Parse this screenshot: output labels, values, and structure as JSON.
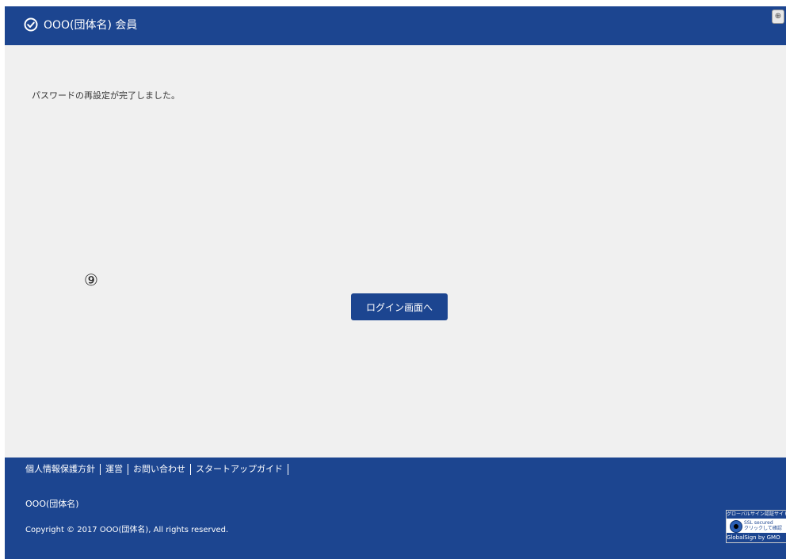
{
  "header": {
    "title": "OOO(団体名)  会員"
  },
  "main": {
    "message": "パスワードの再設定が完了しました。",
    "marker": "⑨",
    "login_button_label": "ログイン画面へ"
  },
  "footer": {
    "links": [
      "個人情報保護方針",
      "運営",
      "お問い合わせ",
      "スタートアップガイド"
    ],
    "org_name": "OOO(団体名)",
    "copyright": "Copyright © 2017 OOO(団体名), All rights reserved.",
    "seal": {
      "top_text": "グローバルサイン認証サイト",
      "mid_text_1": "SSL secured",
      "mid_text_2": "クリックして確認",
      "bottom_text": "GlobalSign by GMO"
    }
  },
  "colors": {
    "brand": "#1c4590",
    "background": "#f0f0f0"
  }
}
